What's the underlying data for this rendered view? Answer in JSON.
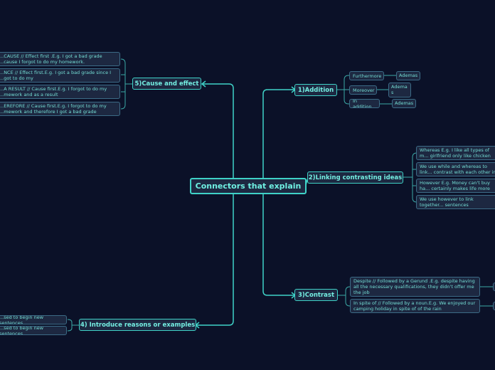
{
  "central": {
    "label": "Connectors that explain"
  },
  "branches": {
    "addition": {
      "label": "1)Addition",
      "items": [
        {
          "label": "Furthermore",
          "child": "Ademas"
        },
        {
          "label": "Moreover",
          "child": "Adema s"
        },
        {
          "label": "In addition",
          "child": "Ademas"
        }
      ]
    },
    "linking": {
      "label": "2)Linking contrasting ideas",
      "items": [
        "Whereas E.g. I like all types of m... girlfriend only like chicken",
        "We use while and whereas to link... contrast with each other in the sa...",
        "However E.g. Money can't buy ha... certainly makes life more comfor...",
        "We use however to link together... sentences"
      ]
    },
    "contrast": {
      "label": "3)Contrast",
      "items": [
        "Despite // Followed by a Gerund .E.g. despite having all the necessary qualifications, they didn't offer me the job",
        "In spite of // Followed by a noun.E.g. We enjoyed our camping holiday in spite of of the rain"
      ]
    },
    "reasons": {
      "label": "4) Introduce reasons or examples",
      "items": [
        "...sed to begin new sentences",
        "...sed to begin new sentences"
      ]
    },
    "cause": {
      "label": "5)Cause and effect",
      "items": [
        "...CAUSE // Effect first .E.g. I got a bad grade ...cause I forgot to do my homework.",
        "...NCE // Effect first.E.g. I got a bad grade since I ...got to do my",
        "...A RESULT // Cause first.E.g. I forgot  to do my ...mework and as a result",
        "...EREFORE //  Cause first.E.g. I forgot to do my ...mework and therefore I got a bad grade"
      ]
    }
  },
  "colors": {
    "background": "#0b1128",
    "accent": "#3fd2c7",
    "node_fill": "#1d2841",
    "sub_border": "#3c6b86"
  }
}
